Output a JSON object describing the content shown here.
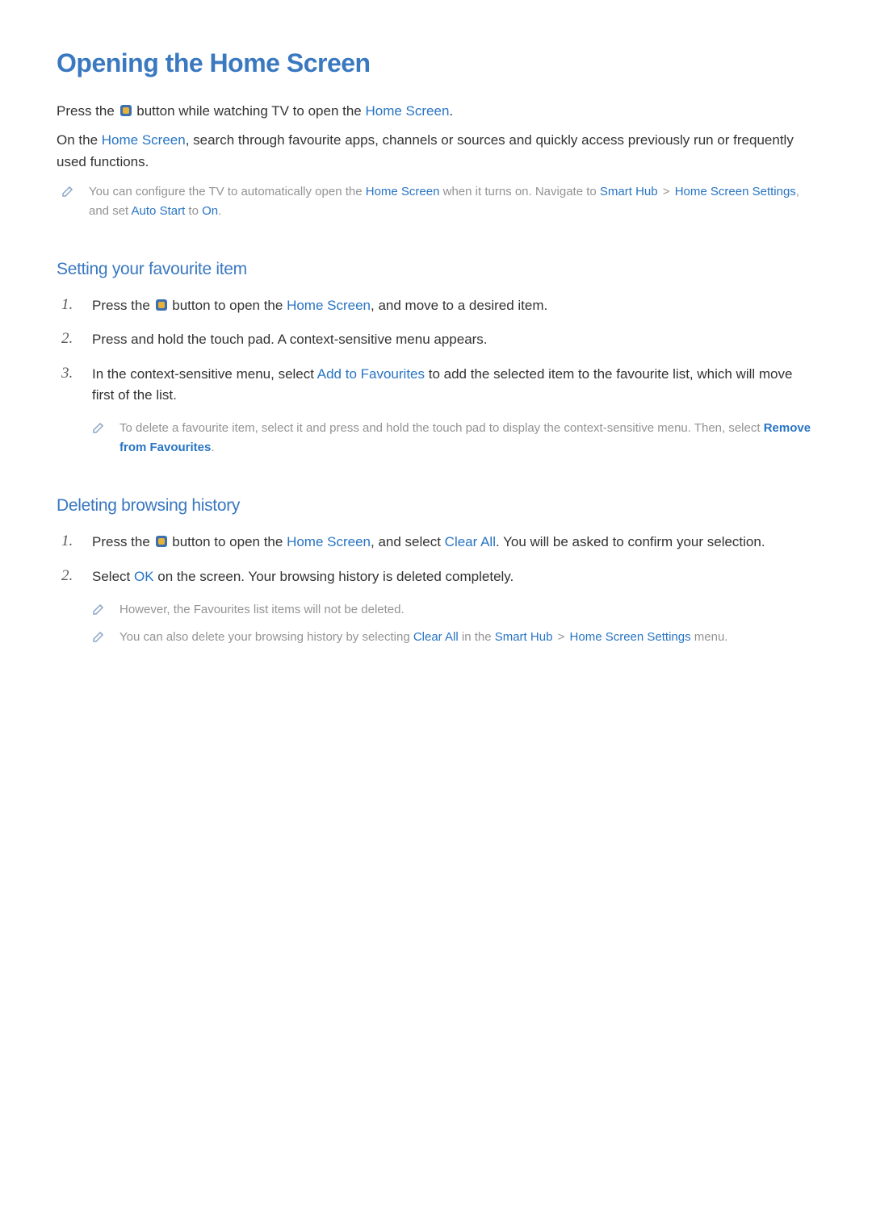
{
  "title": "Opening the Home Screen",
  "intro": {
    "p1_pre": "Press the ",
    "p1_post": " button while watching TV to open the ",
    "p1_hl": "Home Screen",
    "p1_end": ".",
    "p2_pre": "On the ",
    "p2_hl": "Home Screen",
    "p2_post": ", search through favourite apps, channels or sources and quickly access previously run or frequently used functions."
  },
  "intro_note": {
    "t1": "You can configure the TV to automatically open the ",
    "hl1": "Home Screen",
    "t2": " when it turns on. Navigate to ",
    "hl2": "Smart Hub",
    "gt1": " > ",
    "hl3": "Home Screen Settings",
    "t3": ", and set ",
    "hl4": "Auto Start",
    "t4": " to ",
    "hl5": "On",
    "t5": "."
  },
  "section_fav": {
    "heading": "Setting your favourite item",
    "steps": [
      {
        "num": "1.",
        "pre": "Press the ",
        "post": " button to open the ",
        "hl": "Home Screen",
        "end": ", and move to a desired item."
      },
      {
        "num": "2.",
        "text": "Press and hold the touch pad. A context-sensitive menu appears."
      },
      {
        "num": "3.",
        "pre": "In the context-sensitive menu, select ",
        "hl": "Add to Favourites",
        "post": " to add the selected item to the favourite list, which will move first of the list."
      }
    ],
    "note": {
      "t1": "To delete a favourite item, select it and press and hold the touch pad to display the context-sensitive menu. Then, select ",
      "hl": "Remove from Favourites",
      "t2": "."
    }
  },
  "section_del": {
    "heading": "Deleting browsing history",
    "steps": [
      {
        "num": "1.",
        "pre": "Press the ",
        "mid1": " button to open the ",
        "hl1": "Home Screen",
        "mid2": ", and select ",
        "hl2": "Clear All",
        "end": ". You will be asked to confirm your selection."
      },
      {
        "num": "2.",
        "pre": "Select ",
        "hl": "OK",
        "post": " on the screen. Your browsing history is deleted completely."
      }
    ],
    "note1": {
      "text": "However, the Favourites list items will not be deleted."
    },
    "note2": {
      "t1": "You can also delete your browsing history by selecting ",
      "hl1": "Clear All",
      "t2": " in the ",
      "hl2": "Smart Hub",
      "gt": " > ",
      "hl3": "Home Screen Settings",
      "t3": " menu."
    }
  }
}
